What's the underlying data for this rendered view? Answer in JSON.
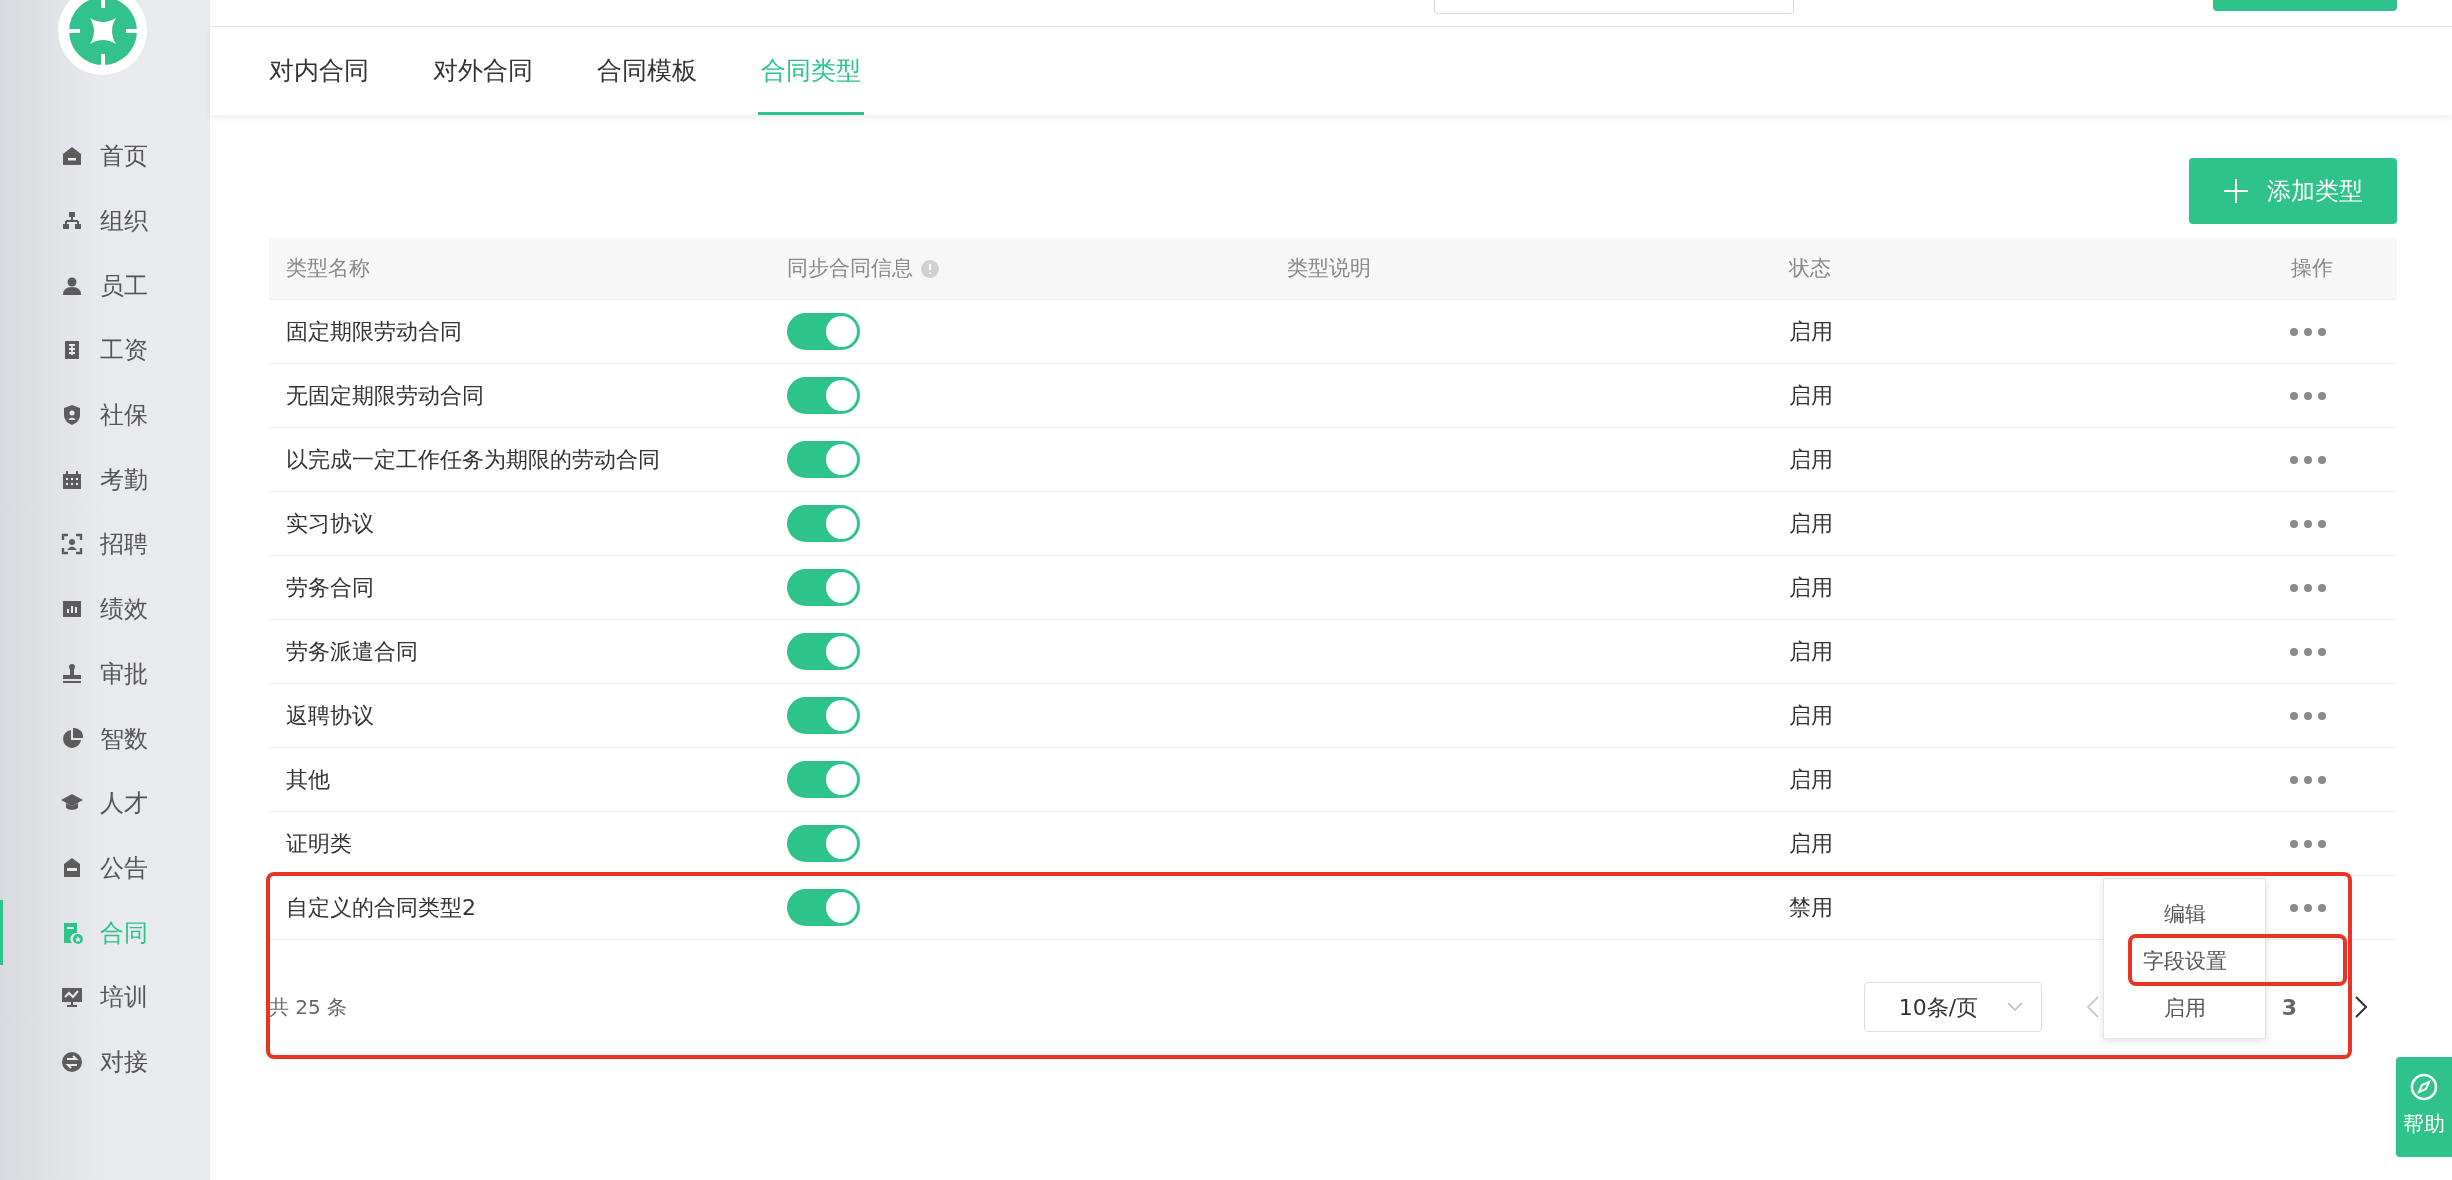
{
  "sidebar": {
    "items": [
      {
        "label": "首页",
        "selected": false
      },
      {
        "label": "组织",
        "selected": false
      },
      {
        "label": "员工",
        "selected": false
      },
      {
        "label": "工资",
        "selected": false
      },
      {
        "label": "社保",
        "selected": false
      },
      {
        "label": "考勤",
        "selected": false
      },
      {
        "label": "招聘",
        "selected": false
      },
      {
        "label": "绩效",
        "selected": false
      },
      {
        "label": "审批",
        "selected": false
      },
      {
        "label": "智数",
        "selected": false
      },
      {
        "label": "人才",
        "selected": false
      },
      {
        "label": "公告",
        "selected": false
      },
      {
        "label": "合同",
        "selected": true
      },
      {
        "label": "培训",
        "selected": false
      },
      {
        "label": "对接",
        "selected": false
      }
    ]
  },
  "tabs": [
    {
      "label": "对内合同",
      "selected": false
    },
    {
      "label": "对外合同",
      "selected": false
    },
    {
      "label": "合同模板",
      "selected": false
    },
    {
      "label": "合同类型",
      "selected": true
    }
  ],
  "add_button": {
    "label": "添加类型"
  },
  "table": {
    "columns": [
      "类型名称",
      "同步合同信息",
      "类型说明",
      "状态",
      "操作"
    ],
    "rows": [
      {
        "name": "固定期限劳动合同",
        "sync": true,
        "status": "启用",
        "highlighted": false
      },
      {
        "name": "无固定期限劳动合同",
        "sync": true,
        "status": "启用",
        "highlighted": false
      },
      {
        "name": "以完成一定工作任务为期限的劳动合同",
        "sync": true,
        "status": "启用",
        "highlighted": false
      },
      {
        "name": "实习协议",
        "sync": true,
        "status": "启用",
        "highlighted": false
      },
      {
        "name": "劳务合同",
        "sync": true,
        "status": "启用",
        "highlighted": false
      },
      {
        "name": "劳务派遣合同",
        "sync": true,
        "status": "启用",
        "highlighted": false
      },
      {
        "name": "返聘协议",
        "sync": true,
        "status": "启用",
        "highlighted": false
      },
      {
        "name": "其他",
        "sync": true,
        "status": "启用",
        "highlighted": false
      },
      {
        "name": "证明类",
        "sync": true,
        "status": "启用",
        "highlighted": false
      },
      {
        "name": "自定义的合同类型2",
        "sync": true,
        "status": "禁用",
        "highlighted": true
      }
    ]
  },
  "pagination": {
    "total": "共 25 条",
    "page_size": "10条/页",
    "prev_disabled": true,
    "pages": [
      {
        "label": "3",
        "selected": true
      }
    ]
  },
  "action_menu": {
    "items": [
      {
        "label": "编辑",
        "highlighted": false
      },
      {
        "label": "字段设置",
        "highlighted": true
      },
      {
        "label": "启用",
        "highlighted": false
      }
    ]
  },
  "help_button": {
    "label": "帮助"
  }
}
